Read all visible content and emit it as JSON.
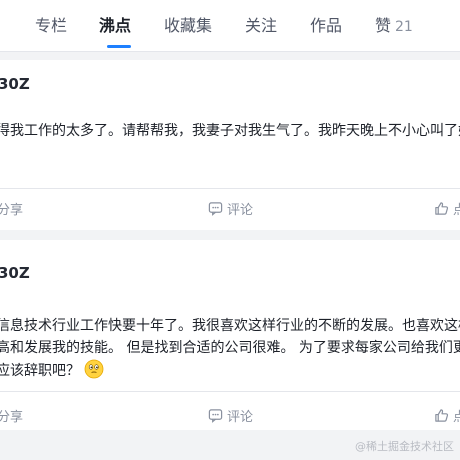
{
  "tabs": [
    {
      "label": "专栏"
    },
    {
      "label": "沸点"
    },
    {
      "label": "收藏集"
    },
    {
      "label": "关注"
    },
    {
      "label": "作品"
    },
    {
      "label": "赞",
      "count": "21"
    }
  ],
  "posts": [
    {
      "author": "30Z",
      "lines": [
        "得我工作的太多了。请帮帮我，我妻子对我生气了。我昨天晚上不小心叫了她“老"
      ],
      "share_label": "分享",
      "comment_label": "评论",
      "like_label": "点"
    },
    {
      "author": "30Z",
      "lines": [
        "信息技术行业工作快要十年了。我很喜欢这样行业的不断的发展。也喜欢这样的",
        "高和发展我的技能。 但是找到合适的公司很难。 为了要求每家公司给我们更好的",
        "应该辞职吧？"
      ],
      "share_label": "分享",
      "comment_label": "评论",
      "like_label": "点"
    }
  ],
  "watermark": "@稀土掘金技术社区",
  "colors": {
    "accent": "#1e80ff",
    "muted": "#8a919f",
    "background": "#f2f3f5"
  }
}
